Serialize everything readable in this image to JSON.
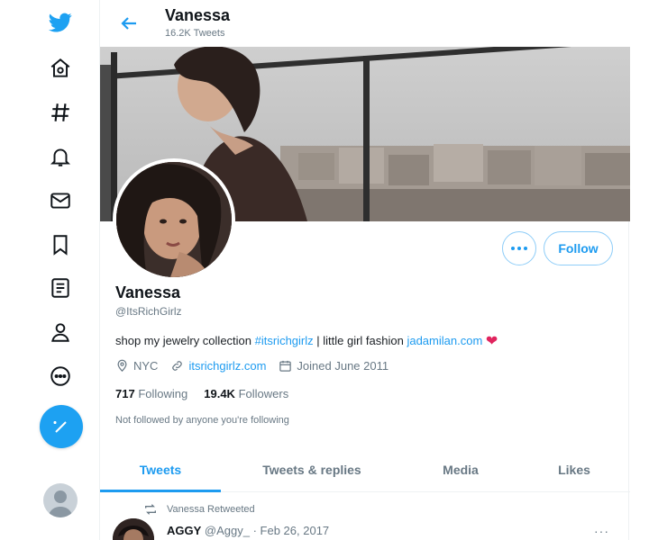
{
  "header": {
    "name": "Vanessa",
    "tweet_count": "16.2K Tweets"
  },
  "profile": {
    "name": "Vanessa",
    "handle": "@ItsRichGirlz",
    "bio_text": "shop my jewelry collection ",
    "bio_hashtag": "#itsrichgirlz",
    "bio_mid": " | little girl fashion ",
    "bio_link": "jadamilan.com",
    "bio_emoji": "❤",
    "location": "NYC",
    "website": "itsrichgirlz.com",
    "joined": "Joined June 2011",
    "following_count": "717",
    "following_label": "Following",
    "followers_count": "19.4K",
    "followers_label": "Followers",
    "followed_by": "Not followed by anyone you're following",
    "follow_button": "Follow"
  },
  "tabs": [
    {
      "label": "Tweets",
      "active": true
    },
    {
      "label": "Tweets & replies",
      "active": false
    },
    {
      "label": "Media",
      "active": false
    },
    {
      "label": "Likes",
      "active": false
    }
  ],
  "tweet": {
    "retweet_label": "Vanessa Retweeted",
    "author_name": "AGGY",
    "author_handle": "@Aggy_",
    "date": "Feb 26, 2017",
    "more": "···"
  },
  "colors": {
    "accent": "#1d9bf0",
    "text": "#0f1419",
    "muted": "#687884",
    "heart": "#e0245e"
  },
  "nav_icons": [
    "twitter-bird-icon",
    "home-icon",
    "explore-hashtag-icon",
    "notifications-bell-icon",
    "messages-envelope-icon",
    "bookmarks-icon",
    "lists-icon",
    "profile-icon",
    "more-icon",
    "compose-tweet-icon"
  ]
}
